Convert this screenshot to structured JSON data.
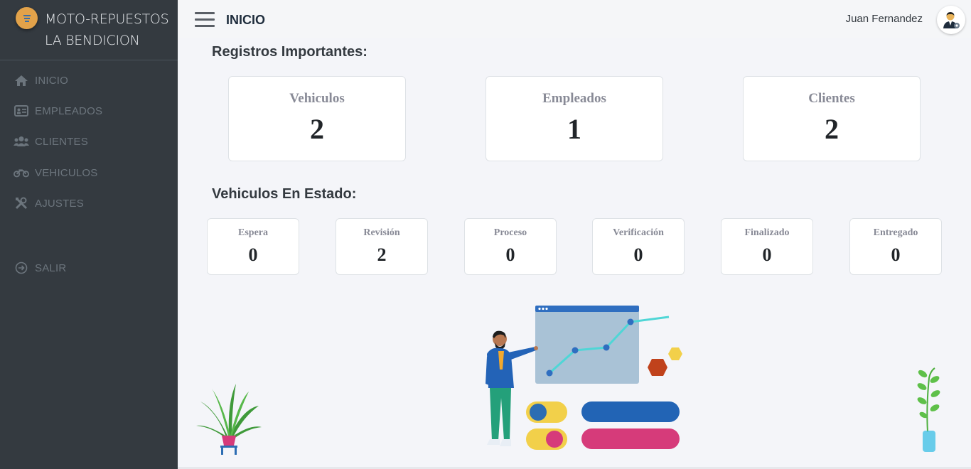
{
  "brand": {
    "line1": "MOTO-REPUESTOS",
    "line2": "LA BENDICION"
  },
  "sidebar": {
    "items": [
      {
        "label": "INICIO",
        "icon": "home-icon"
      },
      {
        "label": "EMPLEADOS",
        "icon": "id-card-icon"
      },
      {
        "label": "CLIENTES",
        "icon": "users-icon"
      },
      {
        "label": "VEHICULOS",
        "icon": "motorcycle-icon"
      },
      {
        "label": "AJUSTES",
        "icon": "tools-icon"
      }
    ],
    "logout": {
      "label": "SALIR",
      "icon": "sign-out-icon"
    }
  },
  "header": {
    "title": "INICIO",
    "user_name": "Juan Fernandez"
  },
  "registros": {
    "title": "Registros Importantes:",
    "cards": [
      {
        "label": "Vehiculos",
        "value": "2"
      },
      {
        "label": "Empleados",
        "value": "1"
      },
      {
        "label": "Clientes",
        "value": "2"
      }
    ]
  },
  "estado": {
    "title": "Vehiculos En Estado:",
    "cards": [
      {
        "label": "Espera",
        "value": "0"
      },
      {
        "label": "Revisión",
        "value": "2"
      },
      {
        "label": "Proceso",
        "value": "0"
      },
      {
        "label": "Verificación",
        "value": "0"
      },
      {
        "label": "Finalizado",
        "value": "0"
      },
      {
        "label": "Entregado",
        "value": "0"
      }
    ]
  },
  "colors": {
    "sidebar_bg": "#343a40",
    "brand_logo": "#e2a24a",
    "content_bg": "#f4f5f9"
  }
}
